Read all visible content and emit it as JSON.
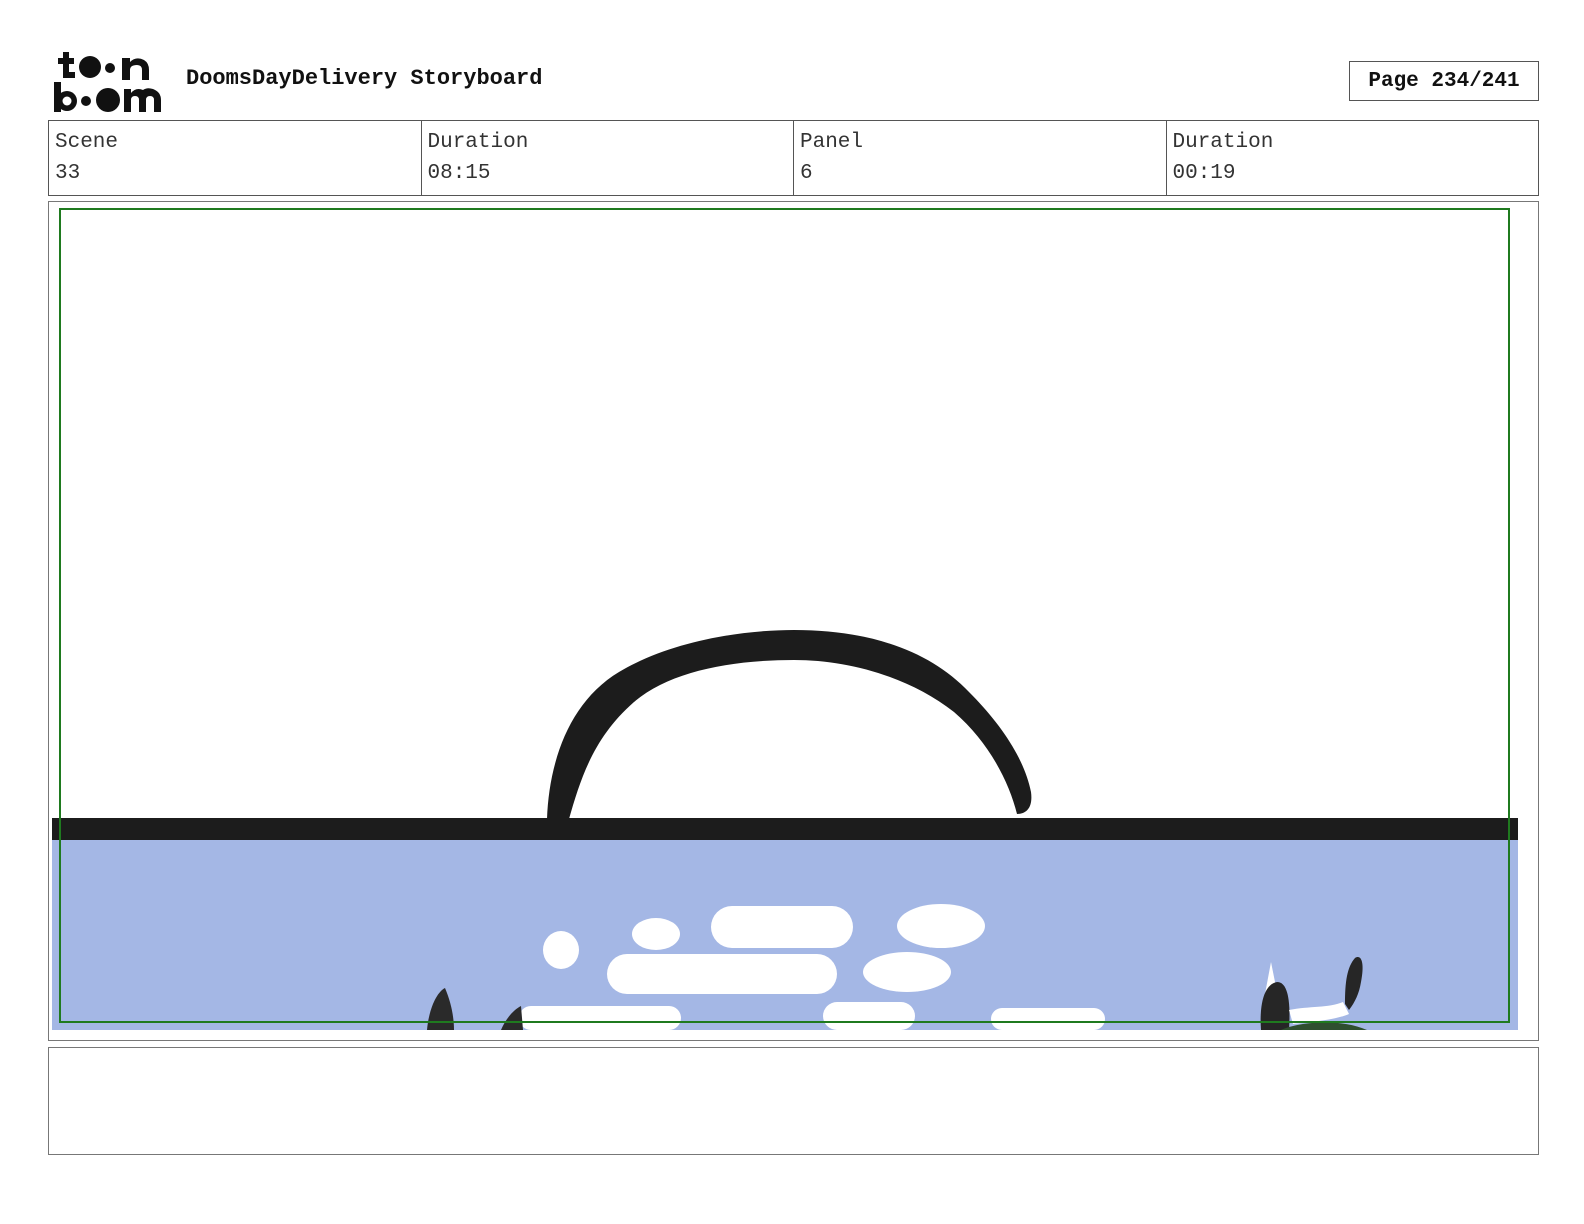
{
  "header": {
    "logo_text_top": "toon",
    "logo_text_bottom": "boom",
    "title": "DoomsDayDelivery Storyboard",
    "page": "Page 234/241"
  },
  "info": {
    "scene_label": "Scene",
    "scene_value": "33",
    "scene_duration_label": "Duration",
    "scene_duration_value": "08:15",
    "panel_label": "Panel",
    "panel_value": "6",
    "panel_duration_label": "Duration",
    "panel_duration_value": "00:19"
  },
  "colors": {
    "sky": "#ffffff",
    "water": "#a4b7e5",
    "ink": "#1c1c1c",
    "safe_frame": "#1f7a1f"
  },
  "notes": {
    "text": ""
  }
}
